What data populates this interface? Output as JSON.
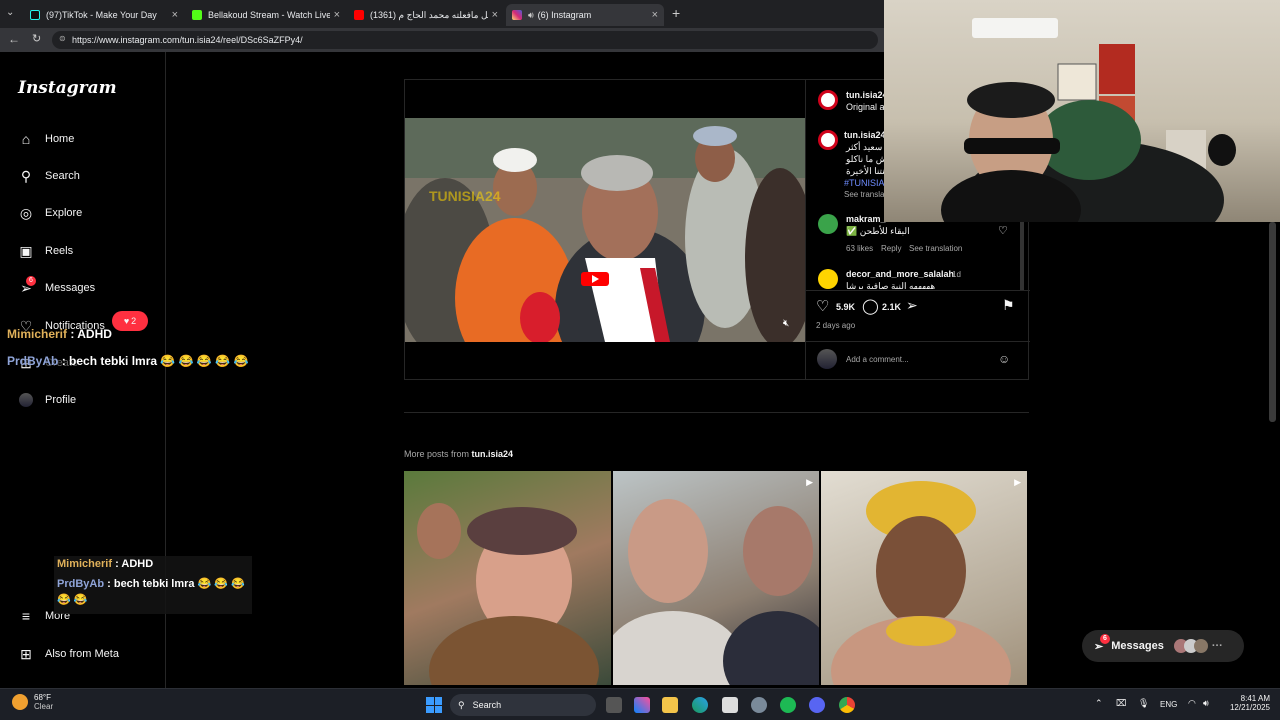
{
  "browser": {
    "tabs": [
      {
        "title": "(97)TikTok - Make Your Day",
        "color": "#111111"
      },
      {
        "title": "Bellakoud Stream - Watch Live on",
        "color": "#53fc18"
      },
      {
        "title": "(1361) أفضل مافعلته محمد الحاج م",
        "color": "#ff0000"
      },
      {
        "title": "(6) Instagram",
        "color": "#d62976"
      }
    ],
    "url": "https://www.instagram.com/tun.isia24/reel/DSc6SaZFPy4/"
  },
  "sidebar": {
    "logo": "Instagram",
    "items": [
      {
        "label": "Home",
        "icon": "home-icon"
      },
      {
        "label": "Search",
        "icon": "search-icon"
      },
      {
        "label": "Explore",
        "icon": "compass-icon"
      },
      {
        "label": "Reels",
        "icon": "reels-icon"
      },
      {
        "label": "Messages",
        "icon": "messenger-icon",
        "badge": "6"
      },
      {
        "label": "Notifications",
        "icon": "heart-icon",
        "badge": "2"
      },
      {
        "label": "Create",
        "icon": "plus-icon"
      },
      {
        "label": "Profile",
        "icon": "profile-avatar"
      }
    ],
    "more": "More",
    "meta": "Also from Meta"
  },
  "chat": {
    "lines": [
      {
        "user": "Mimicherif",
        "text": ": ADHD",
        "color": "#e0b15a"
      },
      {
        "user": "PrdByAb",
        "text": ": bech tebki lmra 😂 😂 😂 😂 😂",
        "color": "#8fa4d8"
      }
    ],
    "box_lines": [
      {
        "user": "Mimicherif",
        "text": ": ADHD",
        "color": "#e0b15a"
      },
      {
        "user": "PrdByAb",
        "text": ": bech tebki lmra 😂 😂 😂 😂 😂",
        "color": "#8fa4d8"
      }
    ]
  },
  "post": {
    "video_watermark": "TUNISIA24",
    "author": "tun.isia24",
    "audio": "Original au",
    "caption_author": "tun.isia24",
    "caption_lines": [
      "سعيد أكثر",
      "ش ما ناكلو",
      "صنتنا الأخيرة"
    ],
    "hashtag": "#TUNISIA2",
    "see_translation": "See translat",
    "comments": [
      {
        "user": "makram_",
        "text": "✅ البقاء للأطحن",
        "likes": "63 likes",
        "reply": "Reply",
        "translate": "See translation"
      },
      {
        "user": "decor_and_more_salalah",
        "time": "1d",
        "text": "هههههه النية صافية برشا"
      }
    ],
    "like_count": "5.9K",
    "comment_count": "2.1K",
    "posted": "2 days ago",
    "add_comment_placeholder": "Add a comment..."
  },
  "more_posts": {
    "prefix": "More posts from",
    "author": "tun.isia24"
  },
  "floating_messages": {
    "label": "Messages",
    "badge": "6"
  },
  "taskbar": {
    "weather_temp": "68°F",
    "weather_text": "Clear",
    "search": "Search",
    "lang": "ENG",
    "time": "8:41 AM",
    "date": "12/21/2025"
  }
}
